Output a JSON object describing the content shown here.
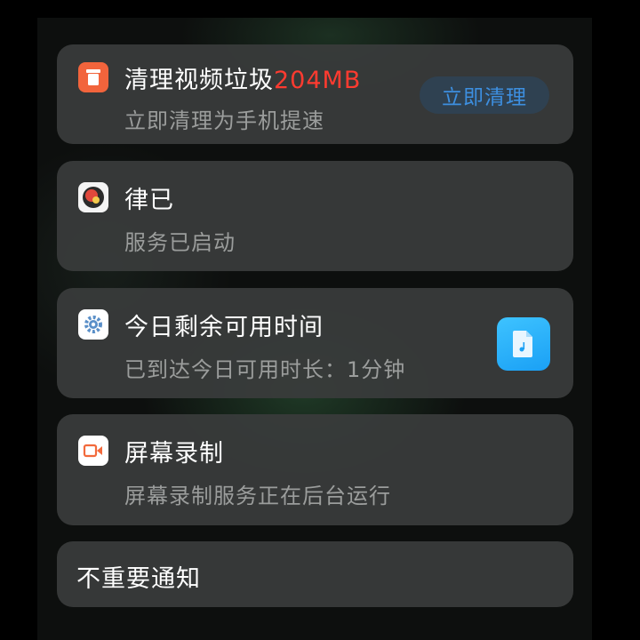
{
  "notifications": [
    {
      "title": "清理视频垃圾",
      "highlight": "204MB",
      "subtitle": "立即清理为手机提速",
      "action_label": "立即清理",
      "icon": "trash-icon"
    },
    {
      "title": "律已",
      "subtitle": "服务已启动",
      "icon": "lvji-app-icon"
    },
    {
      "title": "今日剩余可用时间",
      "subtitle": "已到达今日可用时长：1分钟",
      "icon": "settings-gear-icon",
      "thumbnail_icon": "music-file-icon"
    },
    {
      "title": "屏幕录制",
      "subtitle": "屏幕录制服务正在后台运行",
      "icon": "screen-record-icon"
    }
  ],
  "unimportant": {
    "label": "不重要通知"
  },
  "colors": {
    "highlight": "#ff3b30",
    "action": "#3d8fe0",
    "cleaner_icon_bg": "#f2643c",
    "thumbnail_bg": "#26b0fa"
  }
}
